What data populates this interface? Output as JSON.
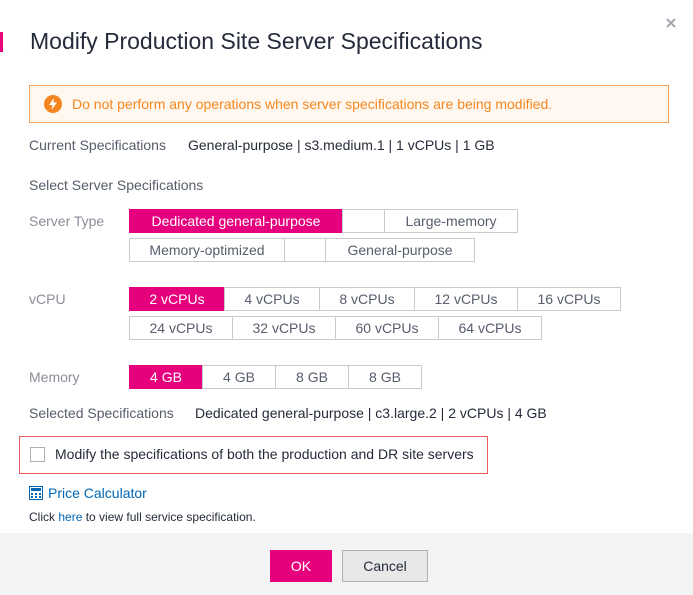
{
  "dialog": {
    "title": "Modify Production Site Server Specifications",
    "close_icon": "close-icon",
    "alert": {
      "icon": "lightning-warning-icon",
      "text": "Do not perform any operations when server specifications are being modified."
    },
    "current_spec": {
      "label": "Current Specifications",
      "value": "General-purpose | s3.medium.1 | 1 vCPUs | 1 GB"
    },
    "select_heading": "Select Server Specifications",
    "server_type": {
      "label": "Server Type",
      "options": [
        "Dedicated general-purpose",
        "",
        "Large-memory",
        "Memory-optimized",
        "",
        "General-purpose"
      ],
      "selected": "Dedicated general-purpose"
    },
    "vcpu": {
      "label": "vCPU",
      "options": [
        "2 vCPUs",
        "4 vCPUs",
        "8 vCPUs",
        "12 vCPUs",
        "16 vCPUs",
        "24 vCPUs",
        "32 vCPUs",
        "60 vCPUs",
        "64 vCPUs"
      ],
      "selected": "2 vCPUs"
    },
    "memory": {
      "label": "Memory",
      "options": [
        "4 GB",
        "4 GB",
        "8 GB",
        "8 GB"
      ],
      "selected_index": 0
    },
    "selected_spec": {
      "label": "Selected Specifications",
      "value": "Dedicated general-purpose | c3.large.2 | 2 vCPUs | 4 GB"
    },
    "both_sites_checkbox": {
      "label": "Modify the specifications of both the production and DR site servers",
      "checked": false
    },
    "price_calculator": {
      "icon": "calculator-icon",
      "label": "Price Calculator"
    },
    "note": {
      "prefix": "Click ",
      "link": "here",
      "suffix": " to view full service specification."
    },
    "buttons": {
      "ok": "OK",
      "cancel": "Cancel"
    }
  },
  "colors": {
    "accent": "#e6007e",
    "warning": "#f5861f",
    "link": "#0066b3",
    "error_border": "#e85a5a"
  }
}
